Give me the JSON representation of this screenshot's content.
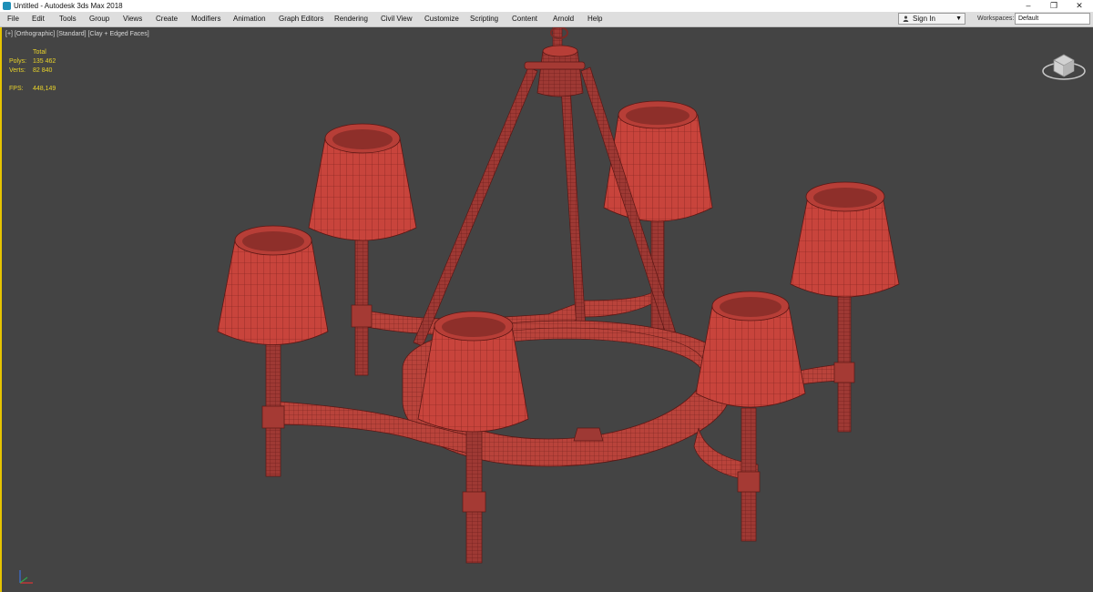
{
  "window": {
    "title": "Untitled - Autodesk 3ds Max 2018",
    "controls": {
      "minimize": "–",
      "restore": "❐",
      "close": "✕"
    }
  },
  "menu": {
    "items": [
      "File",
      "Edit",
      "Tools",
      "Group",
      "Views",
      "Create",
      "Modifiers",
      "Animation",
      "Graph Editors",
      "Rendering",
      "Civil View",
      "Customize",
      "Scripting",
      "Content",
      "Arnold",
      "Help"
    ],
    "signin": "Sign In",
    "workspaces_label": "Workspaces:",
    "workspace_value": "Default"
  },
  "viewport": {
    "label_parts": [
      "[+]",
      "[Orthographic]",
      "[Standard]",
      "[Clay + Edged Faces]"
    ],
    "stats": {
      "header": "Total",
      "polys_label": "Polys:",
      "polys": "135 462",
      "verts_label": "Verts:",
      "verts": "82 840",
      "fps_label": "FPS:",
      "fps": "448,149"
    },
    "model": "chandelier-6-shades",
    "colors": {
      "background": "#444444",
      "active_border": "#e6c400",
      "clay": "#c8443c",
      "stats_text": "#e9d32a"
    }
  }
}
